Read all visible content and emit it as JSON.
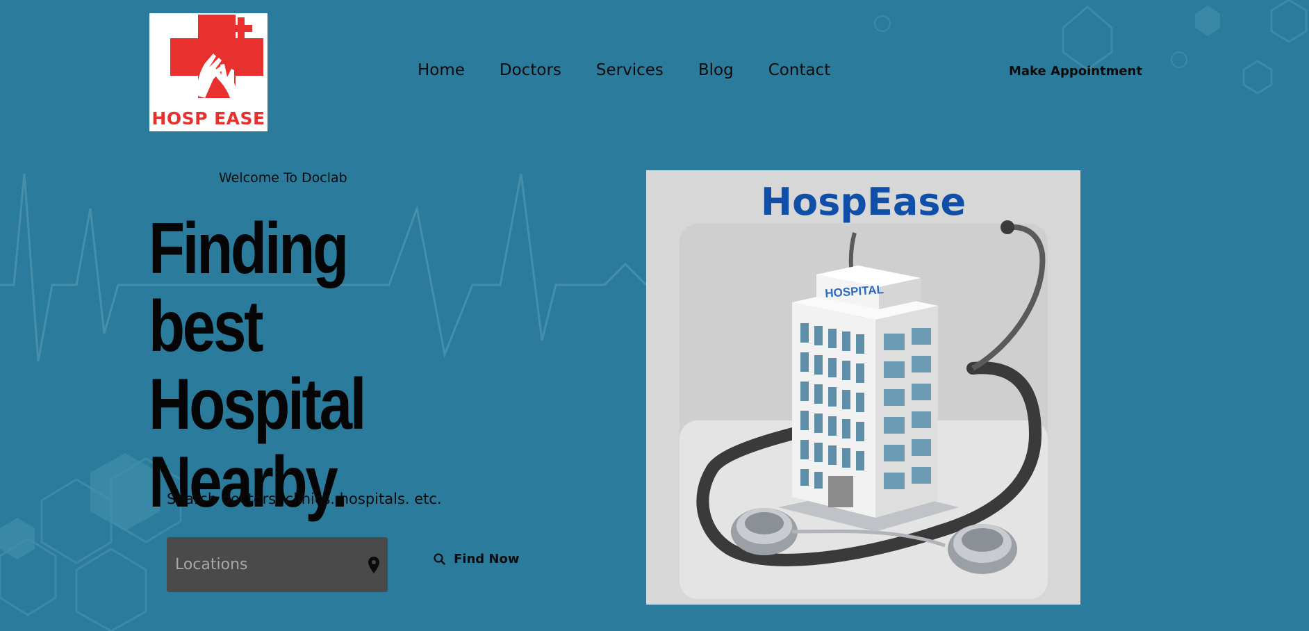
{
  "brand": {
    "logo_text": "HOSP EASE",
    "accent": "#e8312f"
  },
  "nav": {
    "items": [
      {
        "label": "Home"
      },
      {
        "label": "Doctors"
      },
      {
        "label": "Services"
      },
      {
        "label": "Blog"
      },
      {
        "label": "Contact"
      }
    ],
    "cta": "Make Appointment"
  },
  "hero": {
    "welcome": "Welcome To Doclab",
    "headline_lines": [
      "Finding best",
      "Hospital",
      "Nearby."
    ],
    "search_caption": "Search doctors. clinics. hospitals. etc.",
    "location_placeholder": "Locations",
    "find_label": "Find Now",
    "image_title": "HospEase",
    "image_sign": "HOSPITAL"
  },
  "colors": {
    "background": "#2a7b9c",
    "input_bg": "#4a4a4a",
    "image_title": "#0f4fa8"
  }
}
